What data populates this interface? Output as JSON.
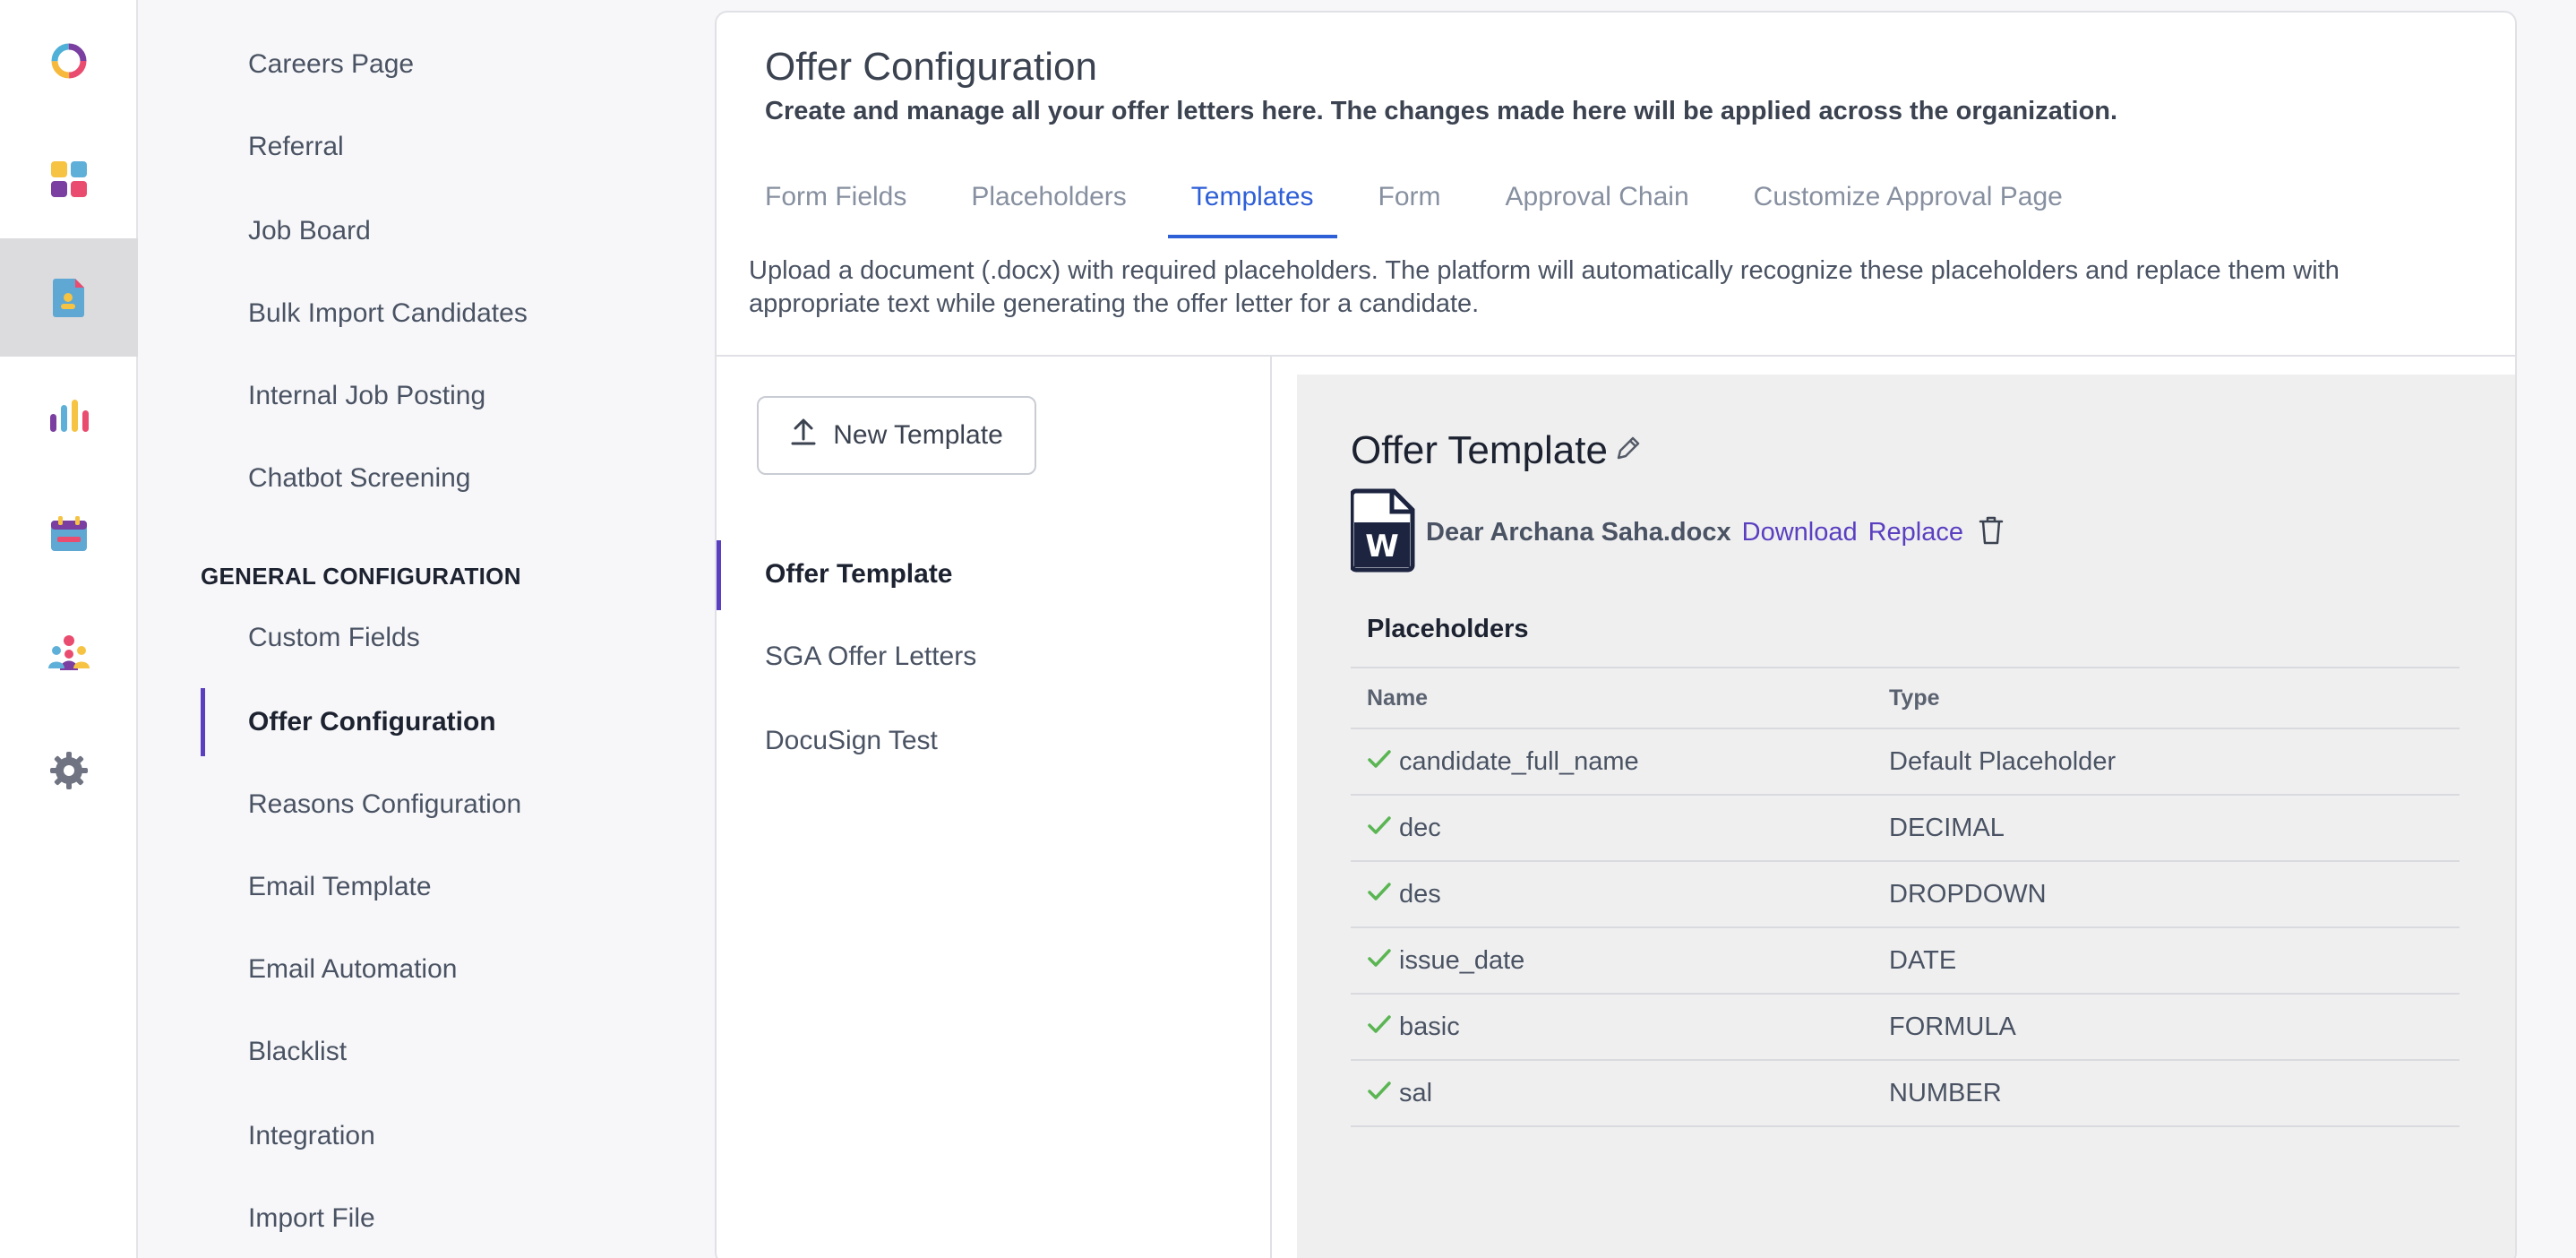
{
  "rail": {
    "items": [
      {
        "name": "logo-icon"
      },
      {
        "name": "dashboard-icon"
      },
      {
        "name": "document-icon",
        "active": true
      },
      {
        "name": "analytics-icon"
      },
      {
        "name": "calendar-icon"
      },
      {
        "name": "team-icon"
      },
      {
        "name": "gear-icon"
      }
    ]
  },
  "sidebar": {
    "top_items": [
      "Careers Page",
      "Referral",
      "Job Board",
      "Bulk Import Candidates",
      "Internal Job Posting",
      "Chatbot Screening"
    ],
    "section_title": "GENERAL CONFIGURATION",
    "section_items": [
      "Custom Fields",
      "Offer Configuration",
      "Reasons Configuration",
      "Email Template",
      "Email Automation",
      "Blacklist",
      "Integration",
      "Import File"
    ],
    "active_item": "Offer Configuration"
  },
  "main": {
    "title": "Offer Configuration",
    "subtitle": "Create and manage all your offer letters here. The changes made here will be applied across the organization.",
    "tabs": [
      "Form Fields",
      "Placeholders",
      "Templates",
      "Form",
      "Approval Chain",
      "Customize Approval Page"
    ],
    "active_tab": "Templates",
    "description": "Upload a document (.docx) with required placeholders. The platform will automatically recognize these placeholders and replace them with appropriate text while generating the offer letter for a candidate."
  },
  "templates": {
    "new_button_label": "New Template",
    "items": [
      "Offer Template",
      "SGA Offer Letters",
      "DocuSign Test"
    ],
    "active": "Offer Template"
  },
  "detail": {
    "title": "Offer Template",
    "file_name": "Dear Archana Saha.docx",
    "download_label": "Download",
    "replace_label": "Replace",
    "placeholders_title": "Placeholders",
    "columns": {
      "name": "Name",
      "type": "Type"
    },
    "rows": [
      {
        "name": "candidate_full_name",
        "type": "Default Placeholder"
      },
      {
        "name": "dec",
        "type": "DECIMAL"
      },
      {
        "name": "des",
        "type": "DROPDOWN"
      },
      {
        "name": "issue_date",
        "type": "DATE"
      },
      {
        "name": "basic",
        "type": "FORMULA"
      },
      {
        "name": "sal",
        "type": "NUMBER"
      }
    ]
  },
  "colors": {
    "accent_purple": "#5a3fc0",
    "tab_blue": "#2e5fd6",
    "check_green": "#5ab552"
  }
}
